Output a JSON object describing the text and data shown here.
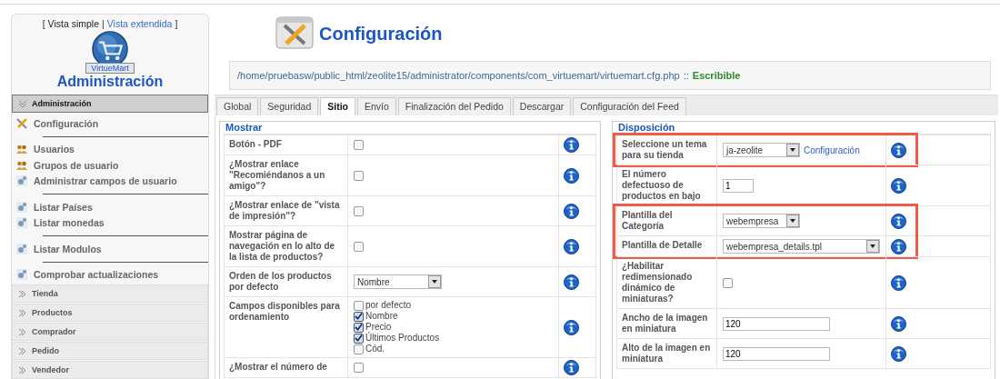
{
  "sidebar": {
    "view_switch": {
      "open": "[",
      "simple": "Vista simple",
      "divider": "|",
      "extended": "Vista extendida",
      "close": "]",
      "simple_selected": true
    },
    "logo_caption": "VirtueMart",
    "title": "Administración",
    "sections": [
      {
        "label": "Administración",
        "expanded": true,
        "groups": [
          [
            {
              "label": "Configuración",
              "kind": "tools"
            }
          ],
          [
            {
              "label": "Usuarios",
              "kind": "users"
            },
            {
              "label": "Grupos de usuario",
              "kind": "users"
            },
            {
              "label": "Administrar campos de usuario",
              "kind": "list"
            }
          ],
          [
            {
              "label": "Listar Países",
              "kind": "list"
            },
            {
              "label": "Listar monedas",
              "kind": "list"
            }
          ],
          [
            {
              "label": "Listar Modulos",
              "kind": "list"
            }
          ],
          [
            {
              "label": "Comprobar actualizaciones",
              "kind": "list"
            }
          ]
        ]
      },
      {
        "label": "Tienda",
        "expanded": false
      },
      {
        "label": "Productos",
        "expanded": false
      },
      {
        "label": "Comprador",
        "expanded": false
      },
      {
        "label": "Pedido",
        "expanded": false
      },
      {
        "label": "Vendedor",
        "expanded": false
      }
    ]
  },
  "page": {
    "title": "Configuración",
    "path": "/home/pruebasw/public_html/zeolite15/administrator/components/com_virtuemart/virtuemart.cfg.php",
    "path_separator": "::",
    "path_status": "Escribible"
  },
  "tabs": [
    {
      "label": "Global",
      "selected": false
    },
    {
      "label": "Seguridad",
      "selected": false
    },
    {
      "label": "Sitio",
      "selected": true
    },
    {
      "label": "Envío",
      "selected": false
    },
    {
      "label": "Finalización del Pedido",
      "selected": false
    },
    {
      "label": "Descargar",
      "selected": false
    },
    {
      "label": "Configuración del Feed",
      "selected": false
    }
  ],
  "mostrar": {
    "legend": "Mostrar",
    "rows": [
      {
        "kind": "checkbox",
        "label": "Botón - PDF",
        "checked": false
      },
      {
        "kind": "checkbox",
        "label": "¿Mostrar enlace \"Recomiéndanos a un amigo\"?",
        "checked": false
      },
      {
        "kind": "checkbox",
        "label": "¿Mostrar enlace de \"vista de impresión\"?",
        "checked": false
      },
      {
        "kind": "checkbox",
        "label": "Mostrar página de navegación en lo alto de la lista de productos?",
        "checked": false
      },
      {
        "kind": "select",
        "label": "Orden de los productos por defecto",
        "value": "Nombre"
      },
      {
        "kind": "checklist",
        "label": "Campos disponibles para ordenamiento",
        "options": [
          {
            "label": "por defecto",
            "checked": false
          },
          {
            "label": "Nombre",
            "checked": true
          },
          {
            "label": "Precio",
            "checked": true
          },
          {
            "label": "Últimos Productos",
            "checked": true
          },
          {
            "label": "Cód.",
            "checked": false
          }
        ]
      },
      {
        "kind": "checkbox",
        "label": "¿Mostrar el número de",
        "checked": false
      }
    ]
  },
  "disposicion": {
    "legend": "Disposición",
    "rows": [
      {
        "kind": "select",
        "label": "Seleccione un tema para su tienda",
        "value": "ja-zeolite",
        "link": "Configuración",
        "highlighted": true
      },
      {
        "kind": "text",
        "label": "El número defectuoso de productos en bajo",
        "value": "1",
        "highlighted": false
      },
      {
        "kind": "select",
        "label": "Plantilla del Categoría",
        "value": "webempresa",
        "highlighted": true
      },
      {
        "kind": "select",
        "label": "Plantilla de Detalle",
        "value": "webempresa_details.tpl",
        "wide": true,
        "highlighted": true
      },
      {
        "kind": "checkbox",
        "label": "¿Habilitar redimensionado dinámico de miniaturas?",
        "checked": false,
        "highlighted": false
      },
      {
        "kind": "text",
        "label": "Ancho de la imagen en miniatura",
        "value": "120",
        "highlighted": false
      },
      {
        "kind": "text",
        "label": "Alto de la imagen en miniatura",
        "value": "120",
        "highlighted": false
      }
    ]
  }
}
